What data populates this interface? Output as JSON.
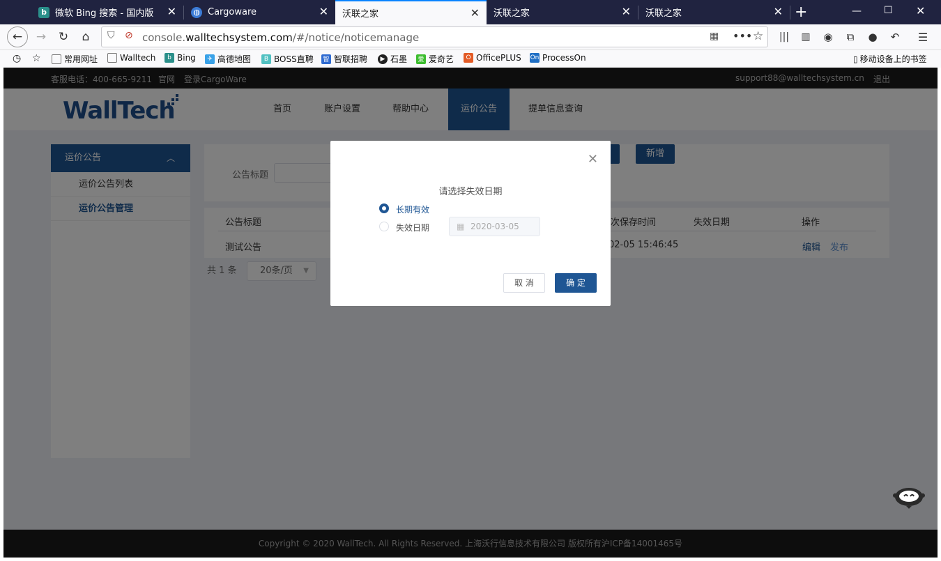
{
  "browser": {
    "tabs": [
      {
        "title": "微软 Bing 搜索 - 国内版",
        "icon": "bing-icon",
        "active": false
      },
      {
        "title": "Cargoware",
        "icon": "globe-icon",
        "active": false
      },
      {
        "title": "沃联之家",
        "icon": "",
        "active": true
      },
      {
        "title": "沃联之家",
        "icon": "",
        "active": false
      },
      {
        "title": "沃联之家",
        "icon": "",
        "active": false
      }
    ],
    "url_prefix": "console.",
    "url_domain": "walltechsystem.com",
    "url_path": "/#/notice/noticemanage",
    "bookmarks": [
      "常用网址",
      "Walltech",
      "Bing",
      "高德地图",
      "BOSS直聘",
      "智联招聘",
      "石墨",
      "爱奇艺",
      "OfficePLUS",
      "ProcessOn"
    ],
    "mobile_bookmarks": "移动设备上的书签"
  },
  "site": {
    "topstrip": {
      "phone": "客服电话：400-665-9211",
      "official": "官网",
      "login": "登录CargoWare",
      "email": "support88@walltechsystem.cn",
      "logout": "退出"
    },
    "logo": "WallTech",
    "menu": [
      "首页",
      "账户设置",
      "帮助中心",
      "运价公告",
      "提单信息查询"
    ],
    "sidebar": {
      "header": "运价公告",
      "items": [
        "运价公告列表",
        "运价公告管理"
      ]
    },
    "search": {
      "label": "公告标题",
      "add_button": "新增"
    },
    "table": {
      "headers": [
        "公告标题",
        "次保存时间",
        "失效日期",
        "操作"
      ],
      "rows": [
        {
          "title": "测试公告",
          "saved": "02-05 15:46:45",
          "edit": "编辑",
          "publish": "发布"
        }
      ]
    },
    "pager": {
      "total": "共 1 条",
      "page_size": "20条/页"
    },
    "footer": "Copyright © 2020 WallTech. All Rights Reserved. 上海沃行信息技术有限公司 版权所有沪ICP备14001465号"
  },
  "modal": {
    "title": "请选择失效日期",
    "option_long": "长期有效",
    "option_date": "失效日期",
    "date_placeholder": "2020-03-05",
    "cancel": "取 消",
    "ok": "确 定"
  },
  "colors": {
    "brand": "#1f5694",
    "tabbar": "#202340"
  }
}
